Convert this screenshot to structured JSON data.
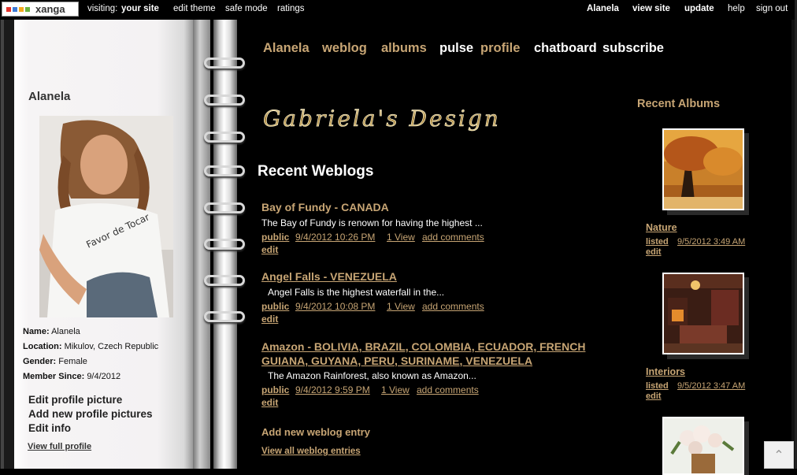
{
  "topbar": {
    "logo_text": "xanga",
    "visiting_label": "visiting:",
    "your_site": "your site",
    "edit_theme": "edit theme",
    "safe_mode": "safe mode",
    "ratings": "ratings",
    "user": "Alanela",
    "view_site": "view site",
    "update": "update",
    "help": "help",
    "sign_out": "sign out"
  },
  "nav": {
    "alanela": "Alanela",
    "weblog": "weblog",
    "albums": "albums",
    "pulse": "pulse",
    "profile": "profile",
    "chatboard": "chatboard",
    "subscribe": "subscribe"
  },
  "sidebar": {
    "name": "Alanela",
    "photo_text": "Favor de Tocar",
    "info": {
      "name_label": "Name:",
      "name_value": "Alanela",
      "location_label": "Location:",
      "location_value": "Mikulov, Czech Republic",
      "gender_label": "Gender:",
      "gender_value": "Female",
      "member_label": "Member Since:",
      "member_value": "9/4/2012"
    },
    "edit_profile_picture": "Edit profile picture",
    "add_profile_pictures": "Add new profile pictures",
    "edit_info": "Edit info",
    "view_full_profile": "View full profile"
  },
  "main": {
    "design_title": "Gabriela's Design",
    "recent_weblogs": "Recent Weblogs",
    "posts": [
      {
        "title": "Bay of Fundy - CANADA",
        "excerpt": "The Bay of Fundy is renown for having the highest ...",
        "visibility": "public",
        "date": "9/4/2012 10:26 PM",
        "views": "1 View",
        "comments": "add comments",
        "edit": "edit"
      },
      {
        "title": "Angel Falls - VENEZUELA",
        "excerpt": "Angel Falls is the highest waterfall in the...",
        "visibility": "public",
        "date": "9/4/2012 10:08 PM",
        "views": "1 View",
        "comments": "add comments",
        "edit": "edit"
      },
      {
        "title_line1": "Amazon - BOLIVIA, BRAZIL, COLOMBIA, ECUADOR, FRENCH",
        "title_line2": "GUIANA, GUYANA, PERU, SURINAME, VENEZUELA",
        "excerpt": "The Amazon Rainforest, also known as Amazon...",
        "visibility": "public",
        "date": "9/4/2012 9:59 PM",
        "views": "1 View",
        "comments": "add comments",
        "edit": "edit"
      }
    ],
    "add_new_entry": "Add new weblog entry",
    "view_all": "View all weblog entries"
  },
  "albums": {
    "heading": "Recent Albums",
    "items": [
      {
        "name": "Nature",
        "status": "listed",
        "date": "9/5/2012 3:49 AM",
        "edit": "edit"
      },
      {
        "name": "Interiors",
        "status": "listed",
        "date": "9/5/2012 3:47 AM",
        "edit": "edit"
      }
    ]
  },
  "colors": {
    "accent_gold": "#c7a574",
    "background": "#000000"
  }
}
